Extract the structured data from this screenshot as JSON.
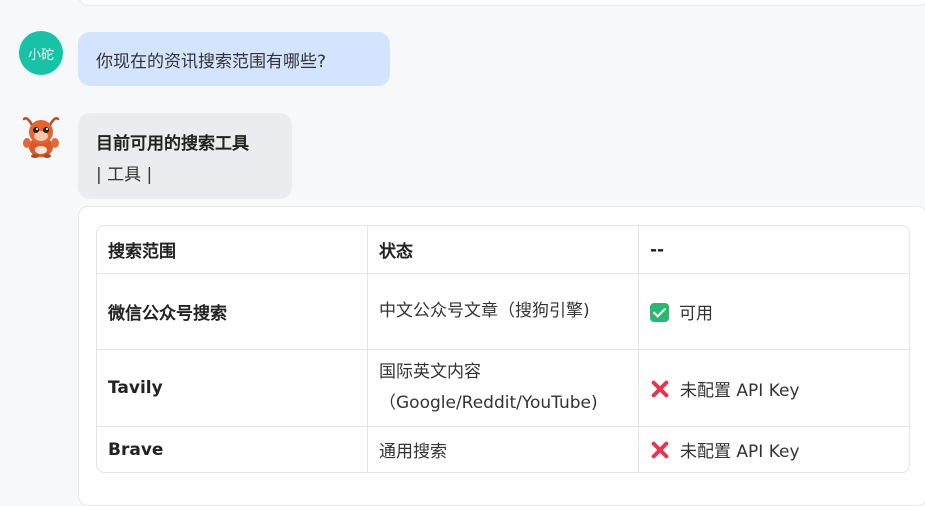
{
  "user": {
    "avatar_label": "小砣",
    "message": "你现在的资讯搜索范围有哪些?"
  },
  "bot": {
    "title": "目前可用的搜索工具",
    "subtitle": "| 工具 |"
  },
  "table": {
    "headers": [
      "搜索范围",
      "状态",
      "--"
    ],
    "rows": [
      {
        "name": "微信公众号搜索",
        "desc": "中文公众号文章（搜狗引擎)",
        "status": "可用",
        "status_icon": "check-icon"
      },
      {
        "name": "Tavily",
        "desc": "国际英文内容（Google/Reddit/YouTube)",
        "status": "未配置 API Key",
        "status_icon": "x-icon"
      },
      {
        "name": "Brave",
        "desc": "通用搜索",
        "status": "未配置 API Key",
        "status_icon": "x-icon"
      }
    ]
  },
  "colors": {
    "user_bubble": "#d4e4ff",
    "avatar": "#17c2a6",
    "check": "#2bb673",
    "cross": "#e8344e"
  }
}
